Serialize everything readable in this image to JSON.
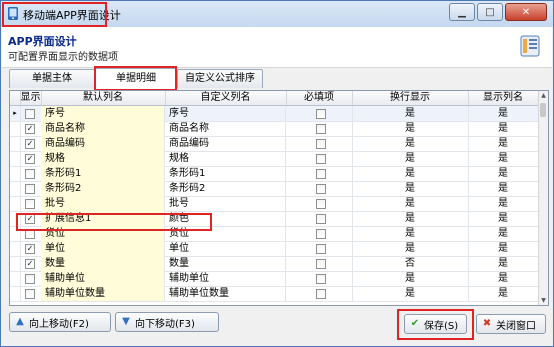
{
  "window": {
    "title": "移动端APP界面设计",
    "buttons": {
      "minimize": "▁",
      "maximize": "□",
      "close": "✕"
    }
  },
  "header": {
    "title": "APP界面设计",
    "subtitle": "可配置界面显示的数据项"
  },
  "tabs": [
    {
      "label": "单据主体"
    },
    {
      "label": "单据明细"
    },
    {
      "label": "自定义公式排序"
    }
  ],
  "columns": [
    "显示",
    "默认列名",
    "自定义列名",
    "必填项",
    "换行显示",
    "显示列名"
  ],
  "rows": [
    {
      "show": false,
      "default_name": "序号",
      "custom_name": "序号",
      "required": false,
      "wrap": "是",
      "show_colname": "是"
    },
    {
      "show": true,
      "default_name": "商品名称",
      "custom_name": "商品名称",
      "required": false,
      "wrap": "是",
      "show_colname": "是"
    },
    {
      "show": true,
      "default_name": "商品编码",
      "custom_name": "商品编码",
      "required": false,
      "wrap": "是",
      "show_colname": "是"
    },
    {
      "show": true,
      "default_name": "规格",
      "custom_name": "规格",
      "required": false,
      "wrap": "是",
      "show_colname": "是"
    },
    {
      "show": false,
      "default_name": "条形码1",
      "custom_name": "条形码1",
      "required": false,
      "wrap": "是",
      "show_colname": "是"
    },
    {
      "show": false,
      "default_name": "条形码2",
      "custom_name": "条形码2",
      "required": false,
      "wrap": "是",
      "show_colname": "是"
    },
    {
      "show": false,
      "default_name": "批号",
      "custom_name": "批号",
      "required": false,
      "wrap": "是",
      "show_colname": "是"
    },
    {
      "show": true,
      "default_name": "扩展信息1",
      "custom_name": "颜色",
      "required": false,
      "wrap": "是",
      "show_colname": "是"
    },
    {
      "show": false,
      "default_name": "货位",
      "custom_name": "货位",
      "required": false,
      "wrap": "是",
      "show_colname": "是"
    },
    {
      "show": true,
      "default_name": "单位",
      "custom_name": "单位",
      "required": false,
      "wrap": "是",
      "show_colname": "是"
    },
    {
      "show": true,
      "default_name": "数量",
      "custom_name": "数量",
      "required": false,
      "wrap": "否",
      "show_colname": "是"
    },
    {
      "show": false,
      "default_name": "辅助单位",
      "custom_name": "辅助单位",
      "required": false,
      "wrap": "是",
      "show_colname": "是"
    },
    {
      "show": false,
      "default_name": "辅助单位数量",
      "custom_name": "辅助单位数量",
      "required": false,
      "wrap": "是",
      "show_colname": "是"
    }
  ],
  "buttons": {
    "move_up": "向上移动(F2)",
    "move_down": "向下移动(F3)",
    "save": "保存(S)",
    "close": "关闭窗口"
  },
  "icons": {
    "checkbox_checked": "✓",
    "row_indicator": "▸",
    "move_up": "▲",
    "move_down": "▼",
    "save": "✔",
    "close": "✖"
  },
  "colors": {
    "highlight": "#e02424",
    "default_col_bg": "#fffcd9",
    "title_bar": "#c4d8ef",
    "header_title": "#0a2a8a"
  }
}
